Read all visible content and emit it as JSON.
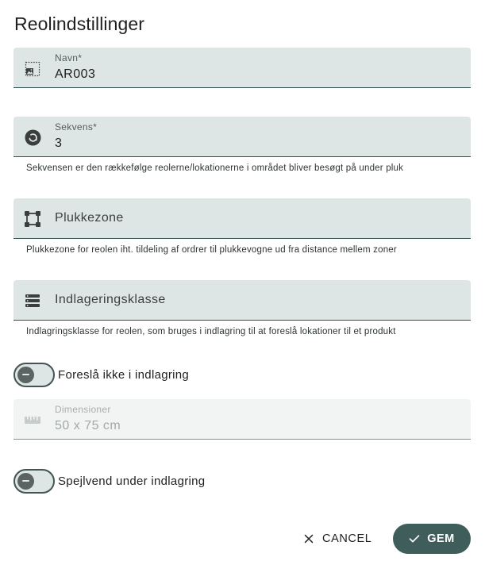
{
  "dialog": {
    "title": "Reolindstillinger"
  },
  "fields": {
    "name": {
      "label": "Navn*",
      "value": "AR003",
      "icon": "image-frame-icon"
    },
    "sequence": {
      "label": "Sekvens*",
      "value": "3",
      "icon": "refresh-circle-icon",
      "hint": "Sekvensen er den rækkefølge reolerne/lokationerne i området bliver besøgt på under pluk"
    },
    "pick_zone": {
      "placeholder": "Plukkezone",
      "icon": "vector-square-icon",
      "hint": "Plukkezone for reolen iht. tildeling af ordrer til plukkevogne ud fra distance mellem zoner"
    },
    "storage_class": {
      "placeholder": "Indlageringsklasse",
      "icon": "server-stack-icon",
      "hint": "Indlagringsklasse for reolen, som bruges i indlagring til at foreslå lokationer til et produkt"
    },
    "dimensions": {
      "label": "Dimensioner",
      "value": "50 x 75 cm",
      "icon": "ruler-icon",
      "disabled": true
    }
  },
  "toggles": {
    "dont_suggest": {
      "label": "Foreslå ikke i indlagring",
      "checked": false
    },
    "mirror": {
      "label": "Spejlvend under indlagring",
      "checked": false
    }
  },
  "actions": {
    "cancel_label": "CANCEL",
    "save_label": "GEM"
  },
  "colors": {
    "field_bg": "#dde6e4",
    "primary": "#3f5d5b",
    "disabled_bg": "#f2f3f3"
  }
}
